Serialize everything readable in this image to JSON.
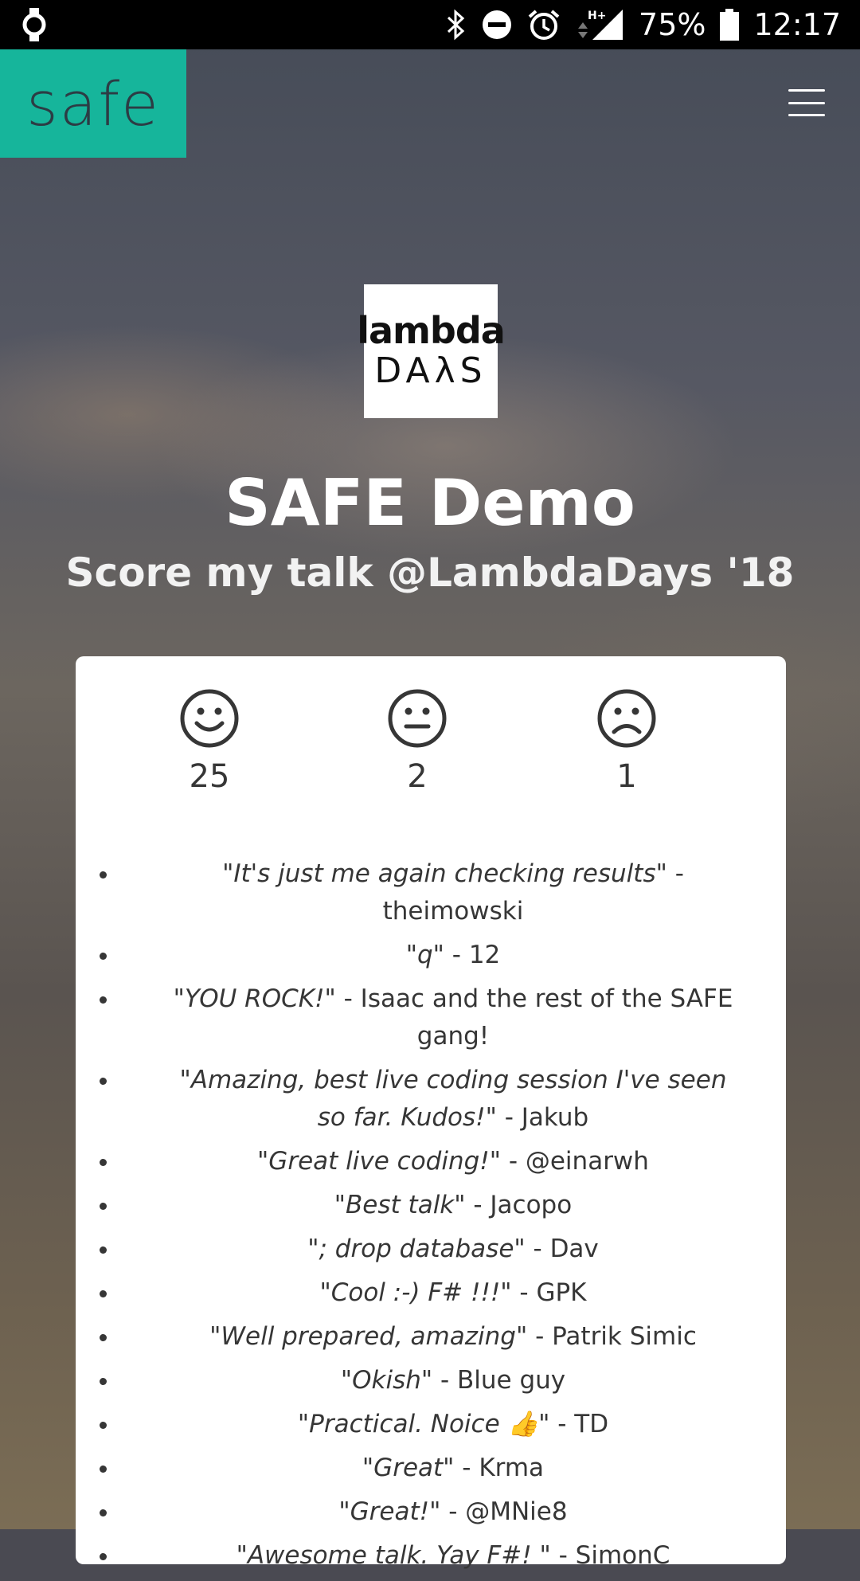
{
  "status_bar": {
    "battery": "75%",
    "time": "12:17",
    "network": "H+"
  },
  "nav": {
    "logo_text": "safe"
  },
  "hero": {
    "event_logo_line1": "lambda",
    "event_logo_line2": "DAλS",
    "title": "SAFE Demo",
    "subtitle": "Score my talk @LambdaDays '18"
  },
  "scores": {
    "happy": "25",
    "neutral": "2",
    "sad": "1"
  },
  "comments": [
    {
      "quote": "\"It's just me again checking results\"",
      "author": " - theimowski"
    },
    {
      "quote": "\"q\"",
      "author": " - 12"
    },
    {
      "quote": "\"YOU ROCK!\"",
      "author": " - Isaac and the rest of the SAFE gang!"
    },
    {
      "quote": "\"Amazing, best live coding session I've seen so far. Kudos!\"",
      "author": " - Jakub"
    },
    {
      "quote": "\"Great live coding!\"",
      "author": " - @einarwh"
    },
    {
      "quote": "\"Best talk\"",
      "author": " - Jacopo"
    },
    {
      "quote": "\"; drop database\"",
      "author": " - Dav"
    },
    {
      "quote": "\"Cool :-) F# !!!\"",
      "author": " - GPK"
    },
    {
      "quote": "\"Well prepared, amazing\"",
      "author": " - Patrik Simic"
    },
    {
      "quote": "\"Okish\"",
      "author": " - Blue guy"
    },
    {
      "quote": "\"Practical. Noice 👍\"",
      "author": " - TD"
    },
    {
      "quote": "\"Great\"",
      "author": " - Krma"
    },
    {
      "quote": "\"Great!\"",
      "author": " - @MNie8"
    },
    {
      "quote": "\"Awesome talk. Yay F#! \"",
      "author": " - SimonC"
    }
  ],
  "colors": {
    "brand": "#16b59b",
    "text": "#363636"
  }
}
